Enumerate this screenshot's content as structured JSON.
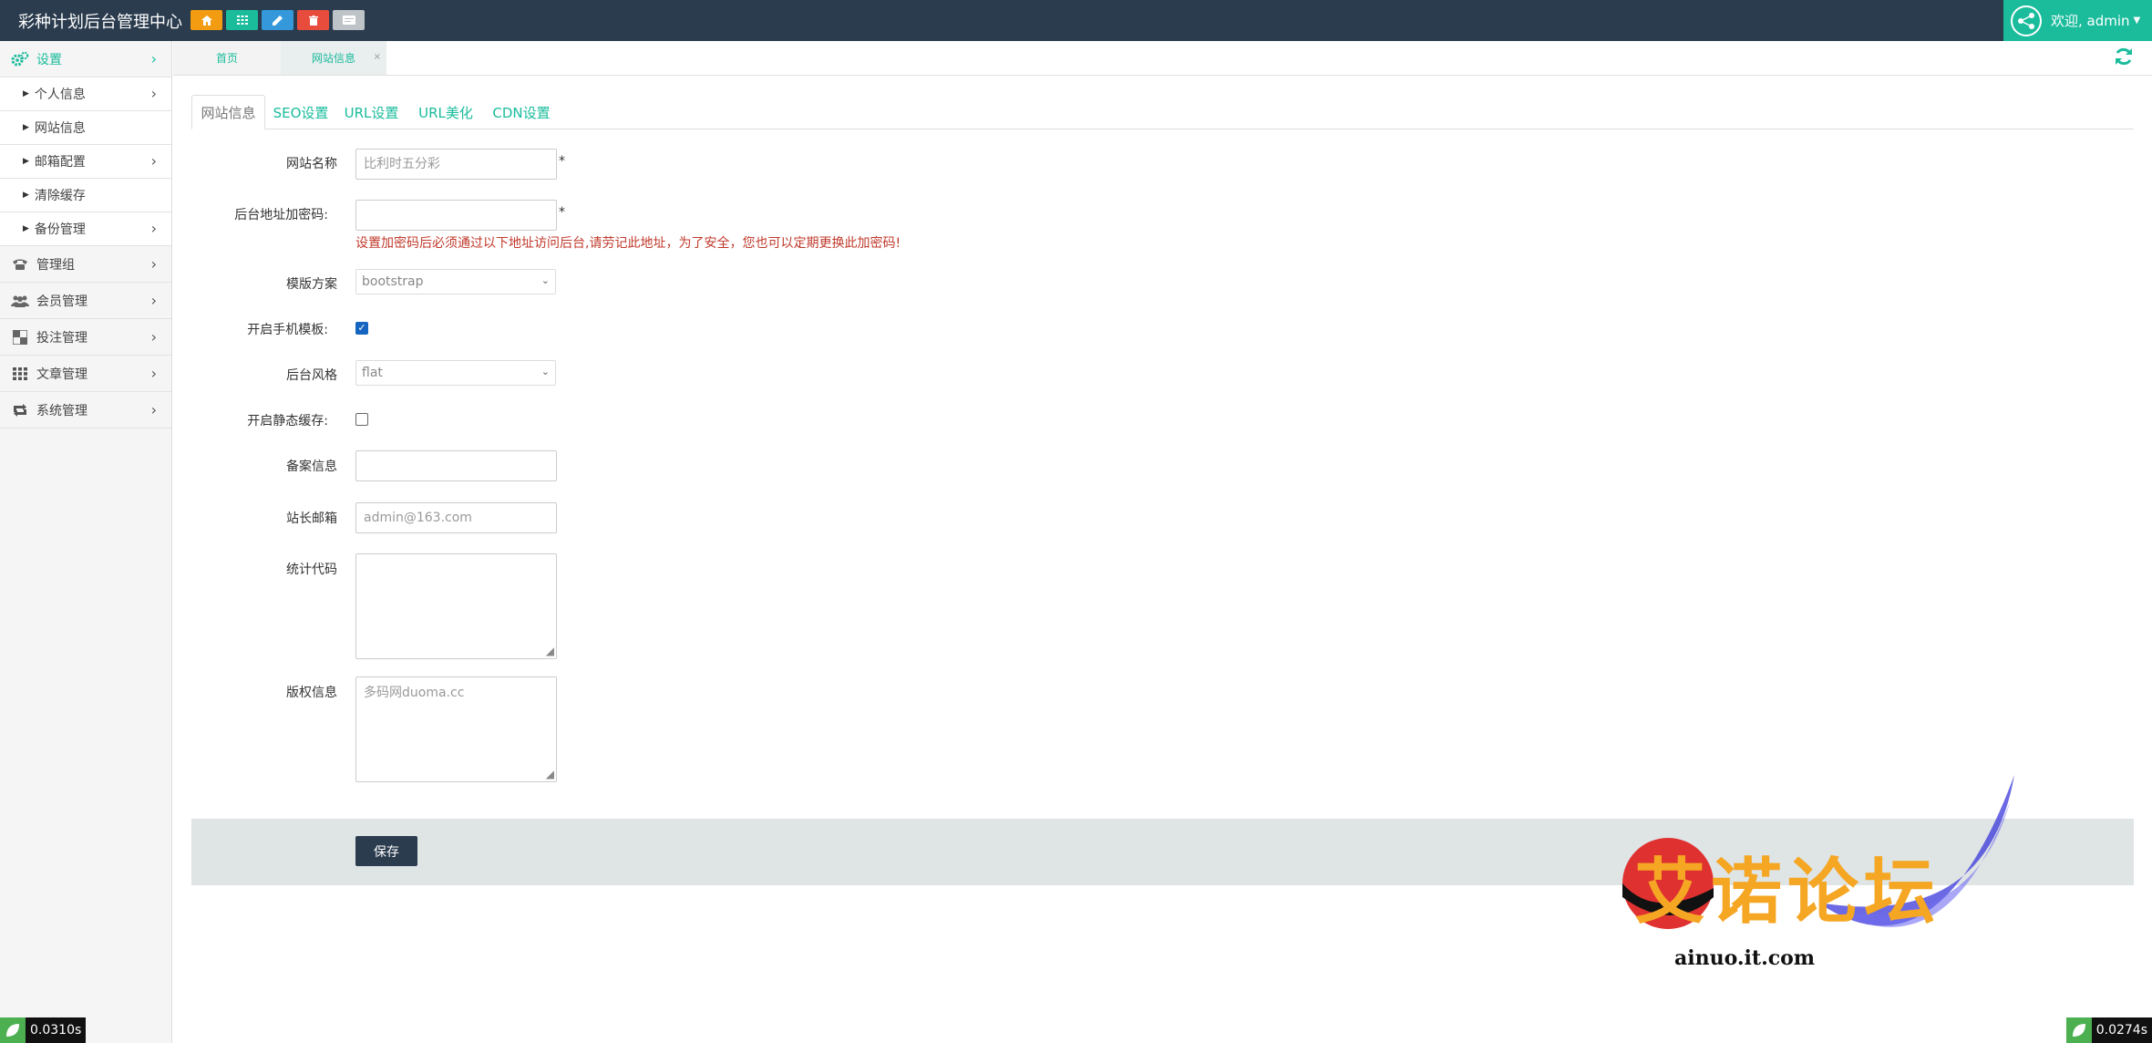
{
  "app": {
    "title": "彩种计划后台管理中心",
    "toolbar": [
      {
        "name": "home-icon",
        "color": "#f39c12"
      },
      {
        "name": "grid-icon",
        "color": "#1abc9c"
      },
      {
        "name": "pencil-icon",
        "color": "#3498db"
      },
      {
        "name": "trash-icon",
        "color": "#e74c3c"
      },
      {
        "name": "card-icon",
        "color": "#bdc3c7"
      }
    ],
    "user": {
      "welcome": "欢迎, admin"
    }
  },
  "sidebar": {
    "settings": {
      "label": "设置",
      "icon": "gears-icon"
    },
    "sub_items": [
      {
        "label": "个人信息",
        "has_chevron": true
      },
      {
        "label": "网站信息",
        "has_chevron": false
      },
      {
        "label": "邮箱配置",
        "has_chevron": true
      },
      {
        "label": "清除缓存",
        "has_chevron": false
      },
      {
        "label": "备份管理",
        "has_chevron": true
      }
    ],
    "groups": [
      {
        "label": "管理组",
        "icon": "phone-icon"
      },
      {
        "label": "会员管理",
        "icon": "users-icon"
      },
      {
        "label": "投注管理",
        "icon": "checker-icon"
      },
      {
        "label": "文章管理",
        "icon": "grid-icon"
      },
      {
        "label": "系统管理",
        "icon": "retweet-icon"
      }
    ]
  },
  "page_tabs": [
    {
      "label": "首页"
    },
    {
      "label": "网站信息",
      "close": "×"
    }
  ],
  "content_tabs": [
    "网站信息",
    "SEO设置",
    "URL设置",
    "URL美化",
    "CDN设置"
  ],
  "form": {
    "site_name": {
      "label": "网站名称",
      "value": "比利时五分彩",
      "required": "*"
    },
    "admin_pwd": {
      "label": "后台地址加密码:",
      "value": "",
      "required": "*",
      "warning": "设置加密码后必须通过以下地址访问后台,请劳记此地址，为了安全，您也可以定期更换此加密码!"
    },
    "template": {
      "label": "模版方案",
      "value": "bootstrap"
    },
    "mobile_template": {
      "label": "开启手机模板:",
      "checked": true
    },
    "admin_style": {
      "label": "后台风格",
      "value": "flat"
    },
    "static_cache": {
      "label": "开启静态缓存:",
      "checked": false
    },
    "icp": {
      "label": "备案信息",
      "value": ""
    },
    "email": {
      "label": "站长邮箱",
      "placeholder": "admin@163.com"
    },
    "stats_code": {
      "label": "统计代码",
      "value": ""
    },
    "copyright": {
      "label": "版权信息",
      "value": "多码网duoma.cc"
    },
    "save": "保存"
  },
  "watermark": {
    "title": "艾诺论坛",
    "url": "ainuo.it.com"
  },
  "timers": {
    "left": "0.0310s",
    "right": "0.0274s"
  }
}
